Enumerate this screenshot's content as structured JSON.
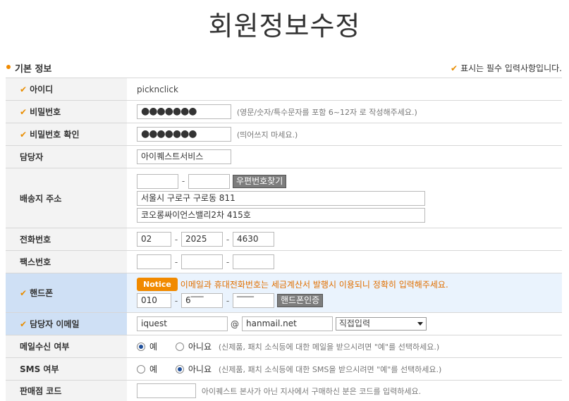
{
  "page_title": "회원정보수정",
  "section": {
    "title": "기본 정보",
    "required_note": "표시는 필수 입력사항입니다."
  },
  "fields": {
    "id": {
      "label": "아이디",
      "value": "picknclick"
    },
    "password": {
      "label": "비밀번호",
      "value": "●●●●●●●",
      "hint": "(영문/숫자/특수문자를 포함 6~12자 로 작성해주세요.)"
    },
    "password_confirm": {
      "label": "비밀번호 확인",
      "value": "●●●●●●●",
      "hint": "(띄어쓰지 마세요.)"
    },
    "contact_person": {
      "label": "담당자",
      "value": "아이퀘스트서비스"
    },
    "address": {
      "label": "배송지 주소",
      "zip1": "",
      "zip2": "",
      "zip_button": "우편번호찾기",
      "line1": "서울시 구로구 구로동 811",
      "line2": "코오롱싸이언스밸리2차 415호"
    },
    "phone": {
      "label": "전화번호",
      "p1": "02",
      "p2": "2025",
      "p3": "4630"
    },
    "fax": {
      "label": "팩스번호",
      "p1": "",
      "p2": "",
      "p3": ""
    },
    "mobile": {
      "label": "핸드폰",
      "notice_badge": "Notice",
      "notice_text": "이메일과 휴대전화번호는 세금계산서 발행시 이용되니 정확히 입력해주세요.",
      "p1": "010",
      "p2": "6‾‾‾",
      "p3": "‾‾‾‾",
      "verify_button": "핸드폰인증"
    },
    "email": {
      "label": "담당자 이메일",
      "local": "iquest",
      "at": "@",
      "domain": "hanmail.net",
      "select": "직접입력"
    },
    "mail_receive": {
      "label": "메일수신 여부",
      "yes": "예",
      "no": "아니요",
      "hint": "(신제품, 패치 소식등에 대한 메일을 받으시려면 \"예\"를 선택하세요.)",
      "selected": "yes"
    },
    "sms_receive": {
      "label": "SMS 여부",
      "yes": "예",
      "no": "아니요",
      "hint": "(신제품, 패치 소식등에 대한 SMS을 받으시려면 \"예\"를 선택하세요.)",
      "selected": "no"
    },
    "dealer_code": {
      "label": "판매점 코드",
      "value": "",
      "hint": "아이퀘스트 본사가 아닌 지사에서 구매하신 분은 코드를 입력하세요."
    }
  },
  "colors": {
    "accent": "#f08a00",
    "highlight_label": "#cfe0f5",
    "highlight_field": "#eaf3fd"
  },
  "icons": {
    "required": "check-icon",
    "bullet": "dot-icon"
  }
}
